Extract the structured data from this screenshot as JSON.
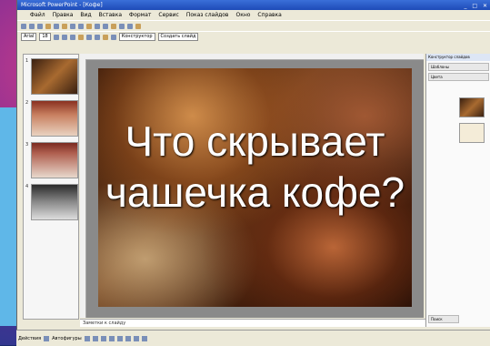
{
  "window": {
    "title": "Microsoft PowerPoint - [Кофе]"
  },
  "menu": [
    "Файл",
    "Правка",
    "Вид",
    "Вставка",
    "Формат",
    "Сервис",
    "Показ слайдов",
    "Окно",
    "Справка"
  ],
  "toolbar": {
    "font_value": "Arial",
    "size_value": "18",
    "design_label": "Конструктор",
    "new_slide_label": "Создать слайд"
  },
  "slides_panel": {
    "items": [
      {
        "number": "1"
      },
      {
        "number": "2"
      },
      {
        "number": "3"
      },
      {
        "number": "4"
      }
    ]
  },
  "slide": {
    "title_line1": "Что скрывает",
    "title_line2": "чашечка кофе?"
  },
  "notes": {
    "placeholder": "Заметки к слайду"
  },
  "task_pane": {
    "title": "Конструктор слайдов",
    "btn1": "Шаблоны",
    "btn2": "Цвета",
    "footer_label": "Поиск"
  },
  "statusbar": {
    "actions_label": "Действия",
    "autoshapes_label": "Автофигуры"
  }
}
